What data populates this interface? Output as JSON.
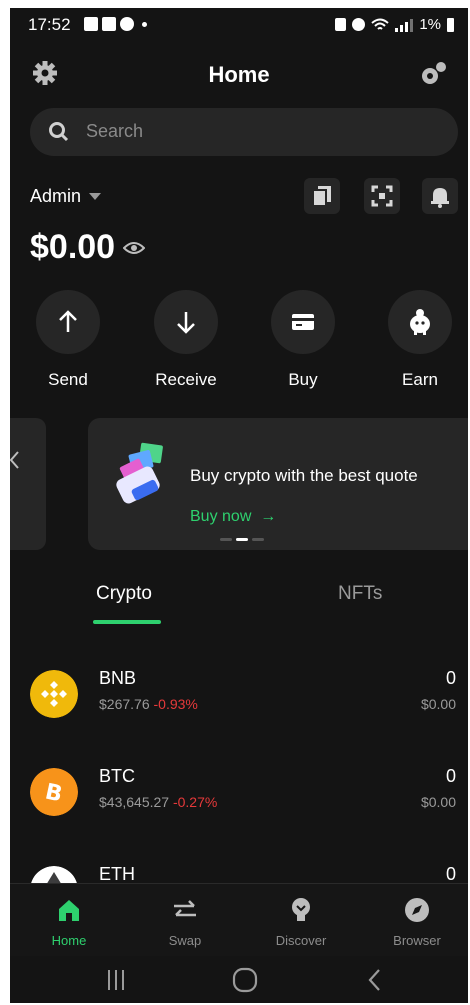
{
  "status": {
    "time": "17:52",
    "battery": "1%"
  },
  "header": {
    "title": "Home"
  },
  "search": {
    "placeholder": "Search"
  },
  "account": {
    "name": "Admin",
    "balance": "$0.00"
  },
  "actions": [
    {
      "label": "Send"
    },
    {
      "label": "Receive"
    },
    {
      "label": "Buy"
    },
    {
      "label": "Earn"
    }
  ],
  "promo": {
    "title": "Buy crypto with the best quote",
    "cta": "Buy now"
  },
  "tabs": {
    "crypto": "Crypto",
    "nfts": "NFTs"
  },
  "assets": [
    {
      "symbol": "BNB",
      "price": "$267.76",
      "change": "-0.93%",
      "balance": "0",
      "usd": "$0.00"
    },
    {
      "symbol": "BTC",
      "price": "$43,645.27",
      "change": "-0.27%",
      "balance": "0",
      "usd": "$0.00"
    },
    {
      "symbol": "ETH",
      "balance": "0"
    }
  ],
  "nav": [
    {
      "label": "Home"
    },
    {
      "label": "Swap"
    },
    {
      "label": "Discover"
    },
    {
      "label": "Browser"
    }
  ],
  "colors": {
    "accent": "#2ed06e",
    "negative": "#e5393a",
    "background": "#141414",
    "surface": "#262626"
  }
}
